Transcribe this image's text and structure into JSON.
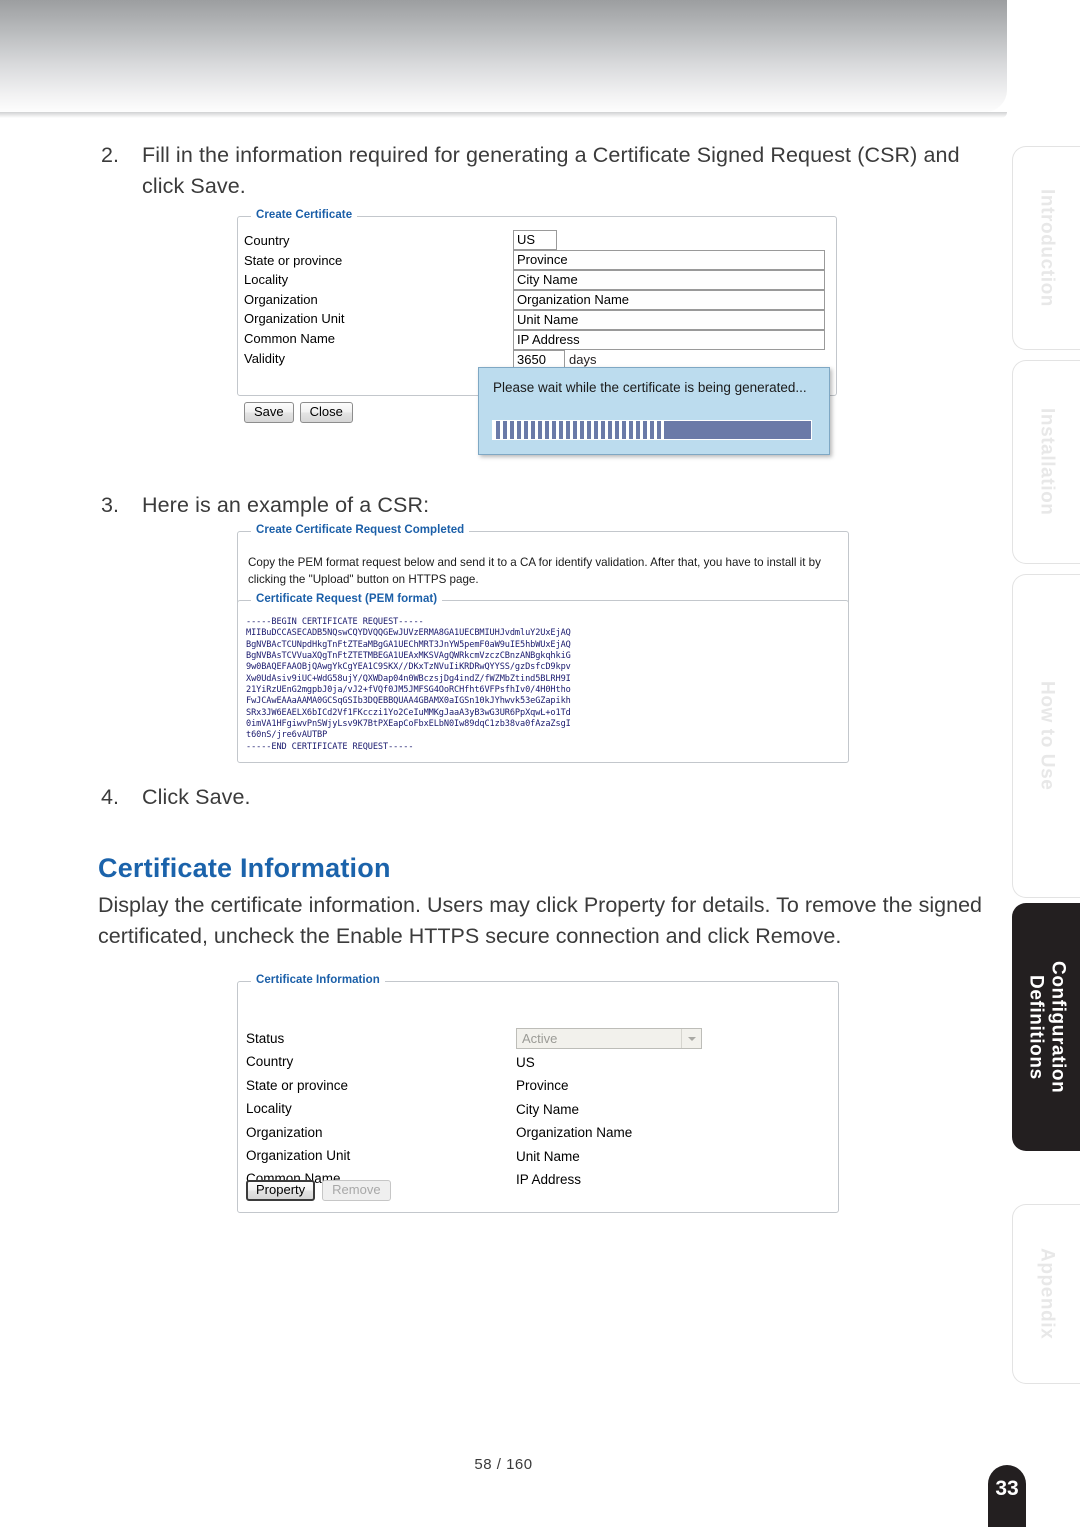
{
  "document": {
    "page_label": "58 / 160",
    "page_badge": "33"
  },
  "steps": {
    "step2_num": "2.",
    "step2_text": "Fill in the information required for generating a Certificate Signed Request (CSR) and click Save.",
    "step3_num": "3.",
    "step3_text": "Here is an example of a CSR:",
    "step4_num": "4.",
    "step4_text": "Click Save."
  },
  "section": {
    "title": "Certificate Information",
    "body": "Display the certificate information. Users may click Property for details. To remove the signed certificated, uncheck the Enable HTTPS secure connection and click Remove."
  },
  "create_certificate": {
    "legend": "Create Certificate",
    "labels": [
      "Country",
      "State or province",
      "Locality",
      "Organization",
      "Organization Unit",
      "Common Name",
      "Validity"
    ],
    "values": {
      "country": "US",
      "state": "Province",
      "locality": "City Name",
      "organization": "Organization Name",
      "organization_unit": "Unit Name",
      "common_name": "IP Address",
      "validity": "3650",
      "validity_suffix": "days"
    },
    "save_label": "Save",
    "close_label": "Close"
  },
  "wait_dialog": {
    "message": "Please wait while the certificate is being generated...",
    "progress_percent": 55
  },
  "csr": {
    "legend_outer": "Create Certificate Request Completed",
    "note": "Copy the PEM format request below and send it to a CA for identify validation. After that, you have to install it by clicking the \"Upload\" button on HTTPS page.",
    "legend_pem": "Certificate Request (PEM format)",
    "pem_text": "-----BEGIN CERTIFICATE REQUEST-----\nMIIBuDCCASECADB5NQswCQYDVQQGEwJUVzERMA8GA1UECBMIUHJvdmluY2UxEjAQ\nBgNVBAcTCUNpdHkgTnFtZTEaMBgGA1UEChMRT3JnYW5pemF0aW9uIE5hbWUxEjAQ\nBgNVBAsTCVVuaXQgTnFtZTETMBEGA1UEAxMKSVAgQWRkcmVzczCBnzANBgkqhkiG\n9w0BAQEFAAOBjQAwgYkCgYEA1C9SKX//DKxTzNVuIiKRDRwQYYSS/gzDsfcD9kpv\nXw0UdAsiv9iUC+WdG58ujY/QXWDap04n0WBczsjDg4indZ/fWZMbZtind5BLRH9I\n21YiRzUEnG2mgpbJ0ja/vJ2+fVQf0JM5JMFSG4OoRCHfht6VFPsfhIv0/4H0Htho\nFwJCAwEAAaAAMA0GCSqGSIb3DQEBBQUAA4GBAMX0aIGSn10kJYhwvk53eGZapikh\nSRx3JW6EAELX6bICd2Vf1FKcczi1Yo2CeIuMMKgJaaA3yB3wG3UR6PpXqwL+o1Td\n0imVA1HFgiwvPnSWjyLsv9K7BtPXEapCoFbxELbN0Iw89dqC1zb38va0fAzaZsgI\nt60nS/jre6vAUTBP\n-----END CERTIFICATE REQUEST-----"
  },
  "certificate_information": {
    "legend": "Certificate Information",
    "labels": [
      "Status",
      "Country",
      "State or province",
      "Locality",
      "Organization",
      "Organization Unit",
      "Common Name"
    ],
    "values": {
      "status": "Active",
      "country": "US",
      "state": "Province",
      "locality": "City Name",
      "organization": "Organization Name",
      "organization_unit": "Unit Name",
      "common_name": "IP Address"
    },
    "property_label": "Property",
    "remove_label": "Remove"
  },
  "rail": {
    "tabs": [
      {
        "label": "Introduction",
        "active": false
      },
      {
        "label": "Installation",
        "active": false
      },
      {
        "label": "How to Use",
        "active": false
      },
      {
        "label": "Configuration\nDefinitions",
        "active": true
      },
      {
        "label": "Appendix",
        "active": false
      }
    ]
  },
  "colors": {
    "heading_blue": "#1b63ab",
    "legend_blue": "#1b5fa8",
    "dialog_blue": "#bcdcee",
    "progress": "#6b7aa8",
    "tab_active": "#231f20"
  }
}
